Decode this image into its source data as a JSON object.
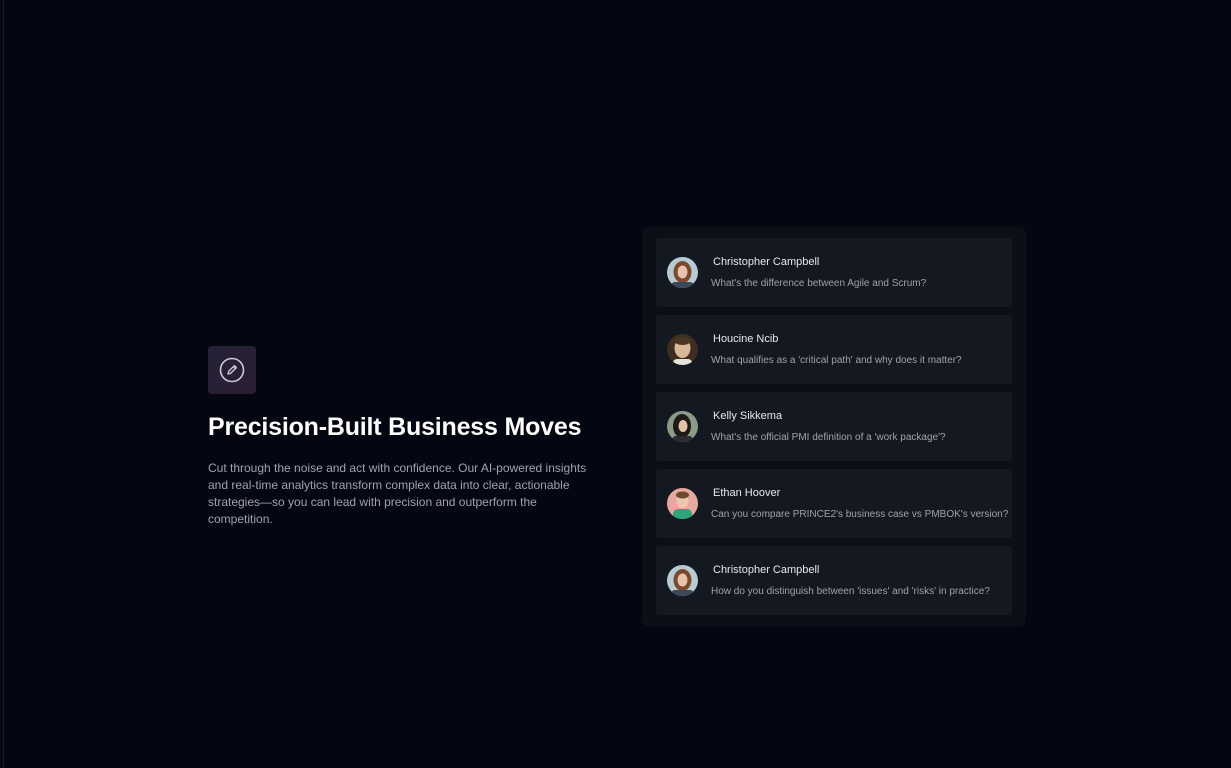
{
  "hero": {
    "icon": "edit-pencil-icon",
    "title": "Precision-Built Business Moves",
    "description": "Cut through the noise and act with confidence. Our AI-powered insights and real-time analytics transform complex data into clear, actionable strategies—so you can lead with precision and outperform the competition."
  },
  "questions": [
    {
      "name": "Christopher Campbell",
      "message": "What's the difference between Agile and Scrum?",
      "avatar": "avatar-photo"
    },
    {
      "name": "Houcine Ncib",
      "message": "What qualifies as a 'critical path' and why does it matter?",
      "avatar": "avatar-photo"
    },
    {
      "name": "Kelly Sikkema",
      "message": "What's the official PMI definition of a 'work package'?",
      "avatar": "avatar-photo"
    },
    {
      "name": "Ethan Hoover",
      "message": "Can you compare PRINCE2's business case vs PMBOK's version?",
      "avatar": "avatar-photo"
    },
    {
      "name": "Christopher Campbell",
      "message": "How do you distinguish between 'issues' and 'risks' in practice?",
      "avatar": "avatar-photo"
    }
  ],
  "colors": {
    "background": "#040611",
    "panel": "#0c0f17",
    "card": "#141821",
    "title": "#ffffff",
    "body_text": "#a0a3ad"
  }
}
